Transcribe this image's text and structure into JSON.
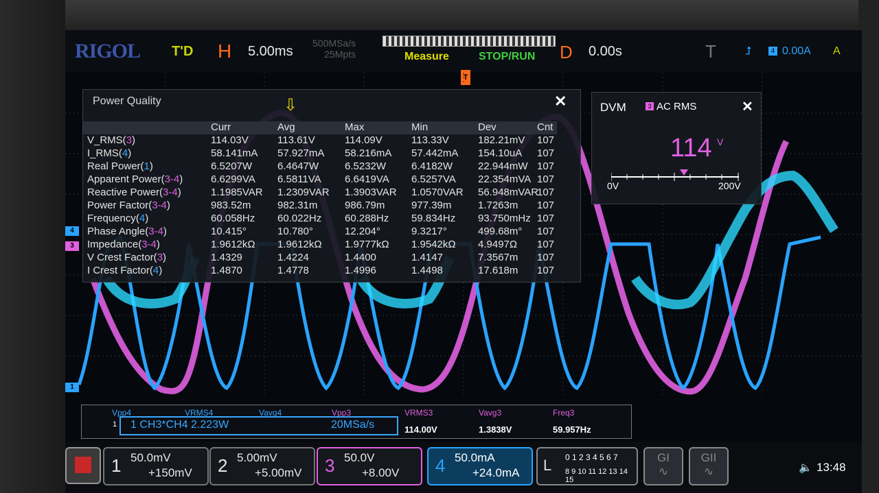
{
  "status": {
    "logo": "RIGOL",
    "trigger_state": "T'D",
    "horizontal_label": "H",
    "timebase": "5.00ms",
    "sample_rate": "500MSa/s",
    "memory_depth": "25Mpts",
    "measure_label": "Measure",
    "stoprun_label": "STOP/RUN",
    "delay_label": "D",
    "delay_value": "0.00s",
    "trigger_label": "T",
    "trigger_channel": "4",
    "trigger_level": "0.00A",
    "coupling": "A",
    "trigger_pos_marker": "T"
  },
  "power_quality": {
    "title": "Power Quality",
    "close": "✕",
    "avg_marker": "⇩",
    "columns": [
      "Curr",
      "Avg",
      "Max",
      "Min",
      "Dev",
      "Cnt"
    ],
    "rows": [
      {
        "name": "V_RMS(",
        "src": "3",
        "srcColor": "mag",
        "tail": ")",
        "vals": [
          "114.03V",
          "113.61V",
          "114.09V",
          "113.33V",
          "182.21mV",
          "107"
        ]
      },
      {
        "name": "I_RMS(",
        "src": "4",
        "srcColor": "blu",
        "tail": ")",
        "vals": [
          "58.141mA",
          "57.927mA",
          "58.216mA",
          "57.442mA",
          "154.10uA",
          "107"
        ]
      },
      {
        "name": "Real Power(",
        "src": "1",
        "srcColor": "blu",
        "tail": ")",
        "vals": [
          "6.5207W",
          "6.4647W",
          "6.5232W",
          "6.4182W",
          "22.944mW",
          "107"
        ]
      },
      {
        "name": "Apparent Power(",
        "src": "3-4",
        "srcColor": "mag",
        "tail": ")",
        "vals": [
          "6.6299VA",
          "6.5811VA",
          "6.6419VA",
          "6.5257VA",
          "22.354mVA",
          "107"
        ]
      },
      {
        "name": "Reactive Power(",
        "src": "3-4",
        "srcColor": "mag",
        "tail": ")",
        "vals": [
          "1.1985VAR",
          "1.2309VAR",
          "1.3903VAR",
          "1.0570VAR",
          "56.948mVAR",
          "107"
        ]
      },
      {
        "name": "Power Factor(",
        "src": "3-4",
        "srcColor": "mag",
        "tail": ")",
        "vals": [
          "983.52m",
          "982.31m",
          "986.79m",
          "977.39m",
          "1.7263m",
          "107"
        ]
      },
      {
        "name": "Frequency(",
        "src": "4",
        "srcColor": "blu",
        "tail": ")",
        "vals": [
          "60.058Hz",
          "60.022Hz",
          "60.288Hz",
          "59.834Hz",
          "93.750mHz",
          "107"
        ]
      },
      {
        "name": "Phase Angle(",
        "src": "3-4",
        "srcColor": "mag",
        "tail": ")",
        "vals": [
          "10.415°",
          "10.780°",
          "12.204°",
          "9.3217°",
          "499.68m°",
          "107"
        ]
      },
      {
        "name": "Impedance(",
        "src": "3-4",
        "srcColor": "mag",
        "tail": ")",
        "vals": [
          "1.9612kΩ",
          "1.9612kΩ",
          "1.9777kΩ",
          "1.9542kΩ",
          "4.9497Ω",
          "107"
        ]
      },
      {
        "name": "V Crest Factor(",
        "src": "3",
        "srcColor": "mag",
        "tail": ")",
        "vals": [
          "1.4329",
          "1.4224",
          "1.4400",
          "1.4147",
          "7.3567m",
          "107"
        ]
      },
      {
        "name": "I Crest Factor(",
        "src": "4",
        "srcColor": "blu",
        "tail": ")",
        "vals": [
          "1.4870",
          "1.4778",
          "1.4996",
          "1.4498",
          "17.618m",
          "107"
        ]
      }
    ]
  },
  "dvm": {
    "title": "DVM",
    "channel": "3",
    "mode": "AC RMS",
    "close": "✕",
    "value": "114",
    "unit": "V",
    "scale_min": "0V",
    "scale_max": "200V",
    "level_fraction": 0.57
  },
  "markers": [
    {
      "label": "4",
      "color": "#2aa3ff"
    },
    {
      "label": "3",
      "color": "#e060e0"
    },
    {
      "label": "1",
      "color": "#2aa3ff"
    }
  ],
  "measurements": {
    "items": [
      {
        "label": "Vpp4",
        "value": "",
        "color": "#3aa8ff"
      },
      {
        "label": "VRMS4",
        "value": "",
        "color": "#3aa8ff"
      },
      {
        "label": "Vavg4",
        "value": "",
        "color": "#3aa8ff"
      },
      {
        "label": "Vpp3",
        "value": "",
        "color": "#e060e0"
      },
      {
        "label": "VRMS3",
        "value": "114.00V",
        "color": "#e060e0"
      },
      {
        "label": "Vavg3",
        "value": "1.3838V",
        "color": "#e060e0"
      },
      {
        "label": "Freq3",
        "value": "59.957Hz",
        "color": "#e060e0"
      }
    ],
    "math_index": "1",
    "math_text": "1  CH3*CH4   2.223W",
    "math_rate": "20MSa/s"
  },
  "channels": [
    {
      "num": "1",
      "scale": "50.0mV",
      "offset": "+150mV",
      "color": "#e8e8e8",
      "border": "#777",
      "bg": "#15181d",
      "textColor": "#e8e8e8"
    },
    {
      "num": "2",
      "scale": "5.00mV",
      "offset": "+5.00mV",
      "color": "#e8e8e8",
      "border": "#777",
      "bg": "#15181d",
      "textColor": "#e8e8e8"
    },
    {
      "num": "3",
      "scale": "50.0V",
      "offset": "+8.00V",
      "color": "#e060e0",
      "border": "#e060e0",
      "bg": "#15181d",
      "textColor": "#e8e8e8"
    },
    {
      "num": "4",
      "scale": "50.0mA",
      "offset": "+24.0mA",
      "color": "#2aa3ff",
      "border": "#2aa3ff",
      "bg": "#0d3d5e",
      "textColor": "#ffffff"
    }
  ],
  "lbox": {
    "label": "L",
    "row1": "0 1 2 3  4 5 6 7",
    "row2": "8 9 10 11 12 13 14 15"
  },
  "gen1": "GI",
  "gen2": "GII",
  "clock": "13:48",
  "volume_icon": "🔈"
}
